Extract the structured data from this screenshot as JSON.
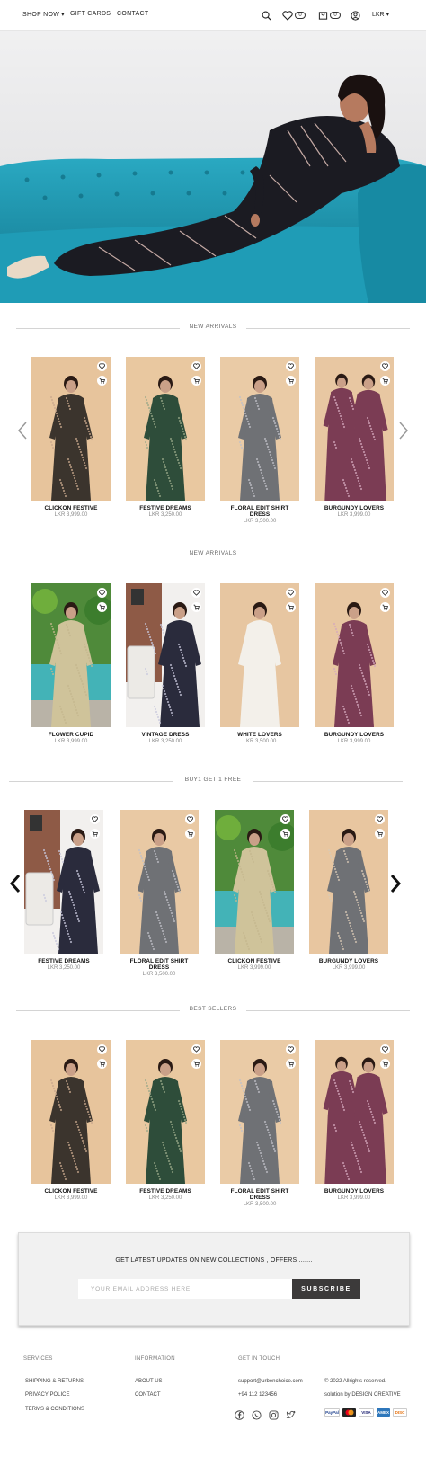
{
  "header": {
    "nav": [
      "SHOP NOW",
      "GIFT CARDS",
      "CONTACT"
    ],
    "wishlist_count": "0",
    "cart_count": "0",
    "currency": "LKR"
  },
  "sections": [
    {
      "title": "NEW ARRIVALS",
      "products": [
        {
          "name": "CLICKON FESTIVE",
          "price": "LKR 3,999.00"
        },
        {
          "name": "FESTIVE DREAMS",
          "price": "LKR 3,250.00"
        },
        {
          "name": "FLORAL EDIT SHIRT DRESS",
          "price": "LKR 3,500.00"
        },
        {
          "name": "BURGUNDY LOVERS",
          "price": "LKR 3,999.00"
        }
      ]
    },
    {
      "title": "NEW ARRIVALS",
      "products": [
        {
          "name": "FLOWER CUPID",
          "price": "LKR 3,999.00"
        },
        {
          "name": "VINTAGE DRESS",
          "price": "LKR 3,250.00"
        },
        {
          "name": "WHITE LOVERS",
          "price": "LKR 3,500.00"
        },
        {
          "name": "BURGUNDY LOVERS",
          "price": "LKR 3,999.00"
        }
      ]
    },
    {
      "title": "BUY1 GET 1 FREE",
      "products": [
        {
          "name": "FESTIVE DREAMS",
          "price": "LKR 3,250.00"
        },
        {
          "name": "FLORAL EDIT SHIRT DRESS",
          "price": "LKR 3,500.00"
        },
        {
          "name": "CLICKON FESTIVE",
          "price": "LKR 3,999.00"
        },
        {
          "name": "BURGUNDY LOVERS",
          "price": "LKR 3,999.00"
        }
      ]
    },
    {
      "title": "BEST SELLERS",
      "products": [
        {
          "name": "CLICKON FESTIVE",
          "price": "LKR 3,999.00"
        },
        {
          "name": "FESTIVE DREAMS",
          "price": "LKR 3,250.00"
        },
        {
          "name": "FLORAL EDIT SHIRT DRESS",
          "price": "LKR 3,500.00"
        },
        {
          "name": "BURGUNDY LOVERS",
          "price": "LKR 3,999.00"
        }
      ]
    }
  ],
  "newsletter": {
    "title": "GET LATEST UPDATES ON NEW COLLECTIONS , OFFERS .......",
    "placeholder": "YOUR EMAIL ADDRESS HERE",
    "button": "SUBSCRIBE"
  },
  "footer": {
    "services": {
      "title": "SERVICES",
      "links": [
        "SHIPPING & RETURNS",
        "PRIVACY POLICE",
        "TERMS & CONDITIONS"
      ]
    },
    "information": {
      "title": "INFORMATION",
      "links": [
        "ABOUT US",
        "CONTACT"
      ]
    },
    "touch": {
      "title": "GET IN TOUCH",
      "email": "support@urbenchoice.com",
      "phone": "+94 112 123456"
    },
    "copyright": "© 2022 Allrights reserved.",
    "credit": "solution by DESIGN CREATIVE",
    "payments": [
      "PayPal",
      "MC",
      "VISA",
      "AMEX",
      "DISC"
    ]
  },
  "colors": {
    "dress_colors": [
      "#3b342d",
      "#2e4d3a",
      "#6f7175",
      "#7b3c54",
      "#cfc39a",
      "#2a2b3c",
      "#f3f0ea"
    ],
    "backdrop": "#e8c9a4",
    "sofa": "#1c8fa6",
    "button_dark": "#3c3a3a"
  }
}
